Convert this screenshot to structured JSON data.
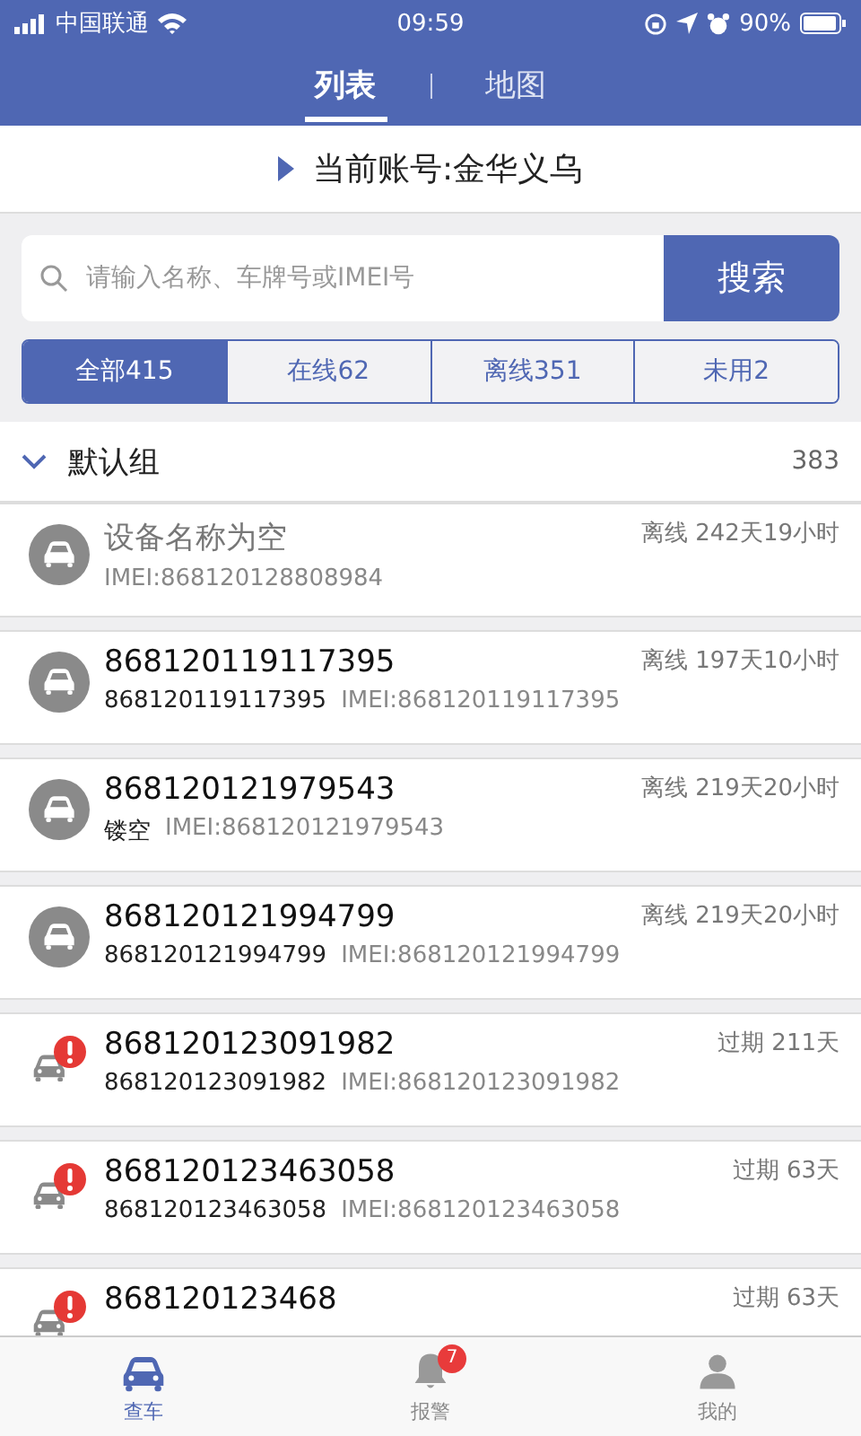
{
  "status_bar": {
    "carrier": "中国联通",
    "time": "09:59",
    "battery": "90%"
  },
  "view_tabs": [
    {
      "label": "列表",
      "selected": true
    },
    {
      "label": "地图",
      "selected": false
    }
  ],
  "account": {
    "label": "当前账号:金华义乌"
  },
  "search": {
    "placeholder": "请输入名称、车牌号或IMEI号",
    "button": "搜索"
  },
  "filters": [
    {
      "label": "全部415",
      "selected": true
    },
    {
      "label": "在线62",
      "selected": false
    },
    {
      "label": "离线351",
      "selected": false
    },
    {
      "label": "未用2",
      "selected": false
    }
  ],
  "group": {
    "name": "默认组",
    "count": "383",
    "expanded": true
  },
  "devices": [
    {
      "kind": "offline",
      "name": "设备名称为空",
      "name_muted": true,
      "imei": "IMEI:868120128808984",
      "status": "离线 242天19小时"
    },
    {
      "kind": "offline",
      "name": "868120119117395",
      "name_muted": false,
      "plate": "868120119117395",
      "imei": "IMEI:868120119117395",
      "status": "离线 197天10小时"
    },
    {
      "kind": "offline",
      "name": "868120121979543",
      "name_muted": false,
      "plate": "镂空",
      "imei": "IMEI:868120121979543",
      "status": "离线 219天20小时"
    },
    {
      "kind": "offline",
      "name": "868120121994799",
      "name_muted": false,
      "plate": "868120121994799",
      "imei": "IMEI:868120121994799",
      "status": "离线 219天20小时"
    },
    {
      "kind": "expired",
      "name": "868120123091982",
      "name_muted": false,
      "plate": "868120123091982",
      "imei": "IMEI:868120123091982",
      "status": "过期 211天"
    },
    {
      "kind": "expired",
      "name": "868120123463058",
      "name_muted": false,
      "plate": "868120123463058",
      "imei": "IMEI:868120123463058",
      "status": "过期 63天"
    },
    {
      "kind": "expired",
      "name": "868120123468",
      "name_muted": false,
      "status": "过期 63天"
    }
  ],
  "bottom_tabs": [
    {
      "label": "查车",
      "kind": "car",
      "selected": true
    },
    {
      "label": "报警",
      "kind": "bell",
      "badge": "7",
      "selected": false
    },
    {
      "label": "我的",
      "kind": "person",
      "selected": false
    }
  ]
}
